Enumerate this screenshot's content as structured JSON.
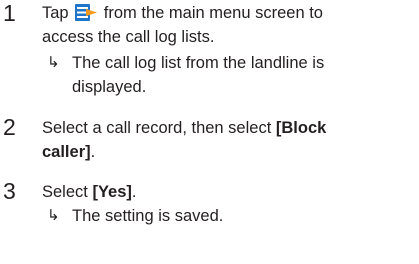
{
  "steps": [
    {
      "number": "1",
      "text_before_icon": "Tap",
      "icon": "call-log-icon",
      "text_after_icon": "from the main menu screen to",
      "text_line2": "access the call log lists.",
      "result_line1": "The call log list from the landline is",
      "result_line2": "displayed."
    },
    {
      "number": "2",
      "text_line1_plain": "Select a call record, then select",
      "text_line1_bold": "[Block",
      "text_line2_bold": "caller]",
      "text_line2_tail": "."
    },
    {
      "number": "3",
      "text_plain": "Select",
      "text_bold": "[Yes]",
      "text_tail": ".",
      "result": "The setting is saved."
    }
  ],
  "result_arrow": "↳",
  "colors": {
    "text": "#231f20",
    "icon_blue": "#1f75c9",
    "icon_orange": "#f39a1e"
  }
}
